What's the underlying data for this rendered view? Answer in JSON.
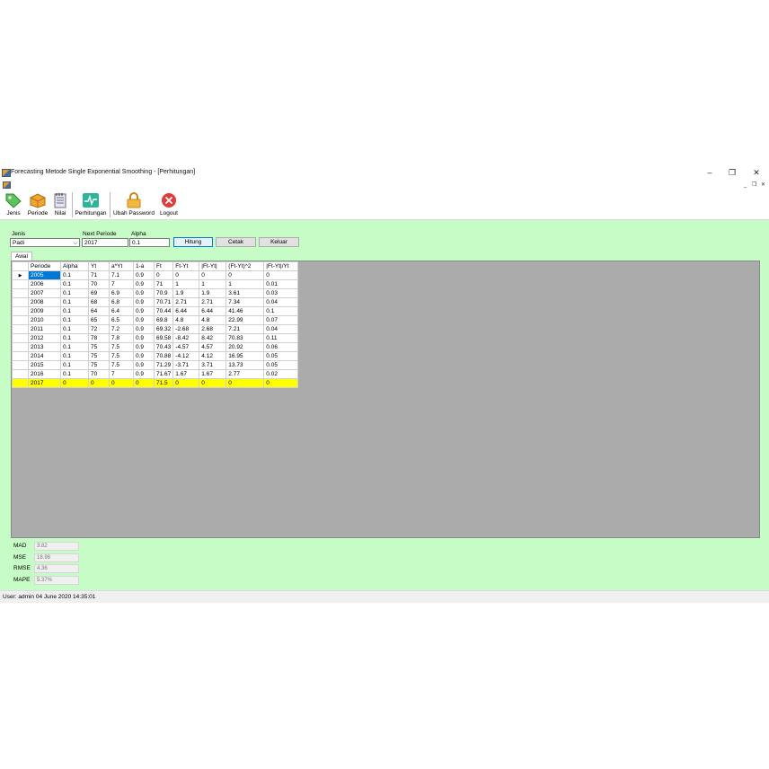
{
  "window": {
    "title": "Forecasting Metode Single Exponential Smoothing - [Perhitungan]"
  },
  "toolbar": [
    {
      "label": "Jenis",
      "icon": "tag-icon"
    },
    {
      "label": "Periode",
      "icon": "box-icon"
    },
    {
      "label": "Nilai",
      "icon": "notepad-icon"
    },
    {
      "label": "Perhitungan",
      "icon": "chart-pulse-icon"
    },
    {
      "label": "Ubah Password",
      "icon": "lock-icon"
    },
    {
      "label": "Logout",
      "icon": "close-circle-icon"
    }
  ],
  "form": {
    "jenis_label": "Jenis",
    "jenis_value": "Padi",
    "next_periode_label": "Next Periode",
    "next_periode_value": "2017",
    "alpha_label": "Alpha",
    "alpha_value": "0.1",
    "hitung_label": "Hitung",
    "cetak_label": "Cetak",
    "keluar_label": "Keluar"
  },
  "tab": {
    "label": "Awal"
  },
  "table": {
    "columns": [
      "Periode",
      "Alpha",
      "Yt",
      "a*Yt",
      "1-a",
      "Ft",
      "Ft-Yt",
      "|Ft-Yt|",
      "(Ft-Yt)^2",
      "|Ft-Yt|/Yt"
    ],
    "current_row_marker": "▶",
    "rows": [
      [
        "2005",
        "0.1",
        "71",
        "7.1",
        "0.9",
        "0",
        "0",
        "0",
        "0",
        "0"
      ],
      [
        "2006",
        "0.1",
        "70",
        "7",
        "0.9",
        "71",
        "1",
        "1",
        "1",
        "0.01"
      ],
      [
        "2007",
        "0.1",
        "69",
        "6.9",
        "0.9",
        "70.9",
        "1.9",
        "1.9",
        "3.61",
        "0.03"
      ],
      [
        "2008",
        "0.1",
        "68",
        "6.8",
        "0.9",
        "70.71",
        "2.71",
        "2.71",
        "7.34",
        "0.04"
      ],
      [
        "2009",
        "0.1",
        "64",
        "6.4",
        "0.9",
        "70.44",
        "6.44",
        "6.44",
        "41.46",
        "0.1"
      ],
      [
        "2010",
        "0.1",
        "65",
        "6.5",
        "0.9",
        "69.8",
        "4.8",
        "4.8",
        "22.99",
        "0.07"
      ],
      [
        "2011",
        "0.1",
        "72",
        "7.2",
        "0.9",
        "69.32",
        "-2.68",
        "2.68",
        "7.21",
        "0.04"
      ],
      [
        "2012",
        "0.1",
        "78",
        "7.8",
        "0.9",
        "69.58",
        "-8.42",
        "8.42",
        "70.83",
        "0.11"
      ],
      [
        "2013",
        "0.1",
        "75",
        "7.5",
        "0.9",
        "70.43",
        "-4.57",
        "4.57",
        "20.92",
        "0.06"
      ],
      [
        "2014",
        "0.1",
        "75",
        "7.5",
        "0.9",
        "70.88",
        "-4.12",
        "4.12",
        "16.95",
        "0.05"
      ],
      [
        "2015",
        "0.1",
        "75",
        "7.5",
        "0.9",
        "71.29",
        "-3.71",
        "3.71",
        "13.73",
        "0.05"
      ],
      [
        "2016",
        "0.1",
        "70",
        "7",
        "0.9",
        "71.67",
        "1.67",
        "1.67",
        "2.77",
        "0.02"
      ],
      [
        "2017",
        "0",
        "0",
        "0",
        "0",
        "71.5",
        "0",
        "0",
        "0",
        "0"
      ]
    ]
  },
  "errors": [
    {
      "label": "MAD",
      "value": "3.82"
    },
    {
      "label": "MSE",
      "value": "18.98"
    },
    {
      "label": "RMSE",
      "value": "4.36"
    },
    {
      "label": "MAPE",
      "value": "5.37%"
    }
  ],
  "status": {
    "text": "User: admin  04 June 2020 14:35:01"
  },
  "colors": {
    "content_bg": "#c6fcc6",
    "grid_bg": "#ababab",
    "highlight_row": "#ffff00",
    "selected_cell": "#0078d7"
  }
}
